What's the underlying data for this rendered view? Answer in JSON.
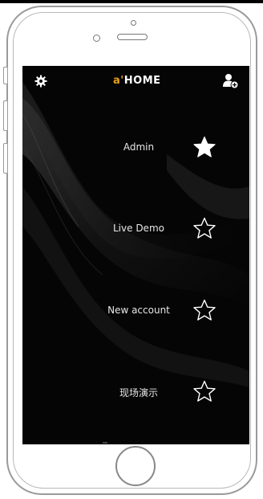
{
  "header": {
    "logo_accent": "a'",
    "logo_rest": "HOME",
    "settings_icon": "gear-icon",
    "add_user_icon": "add-user-icon"
  },
  "accounts": [
    {
      "label": "Admin",
      "favorite": true
    },
    {
      "label": "Live Demo",
      "favorite": false
    },
    {
      "label": "New account",
      "favorite": false
    },
    {
      "label": "现场演示",
      "favorite": false
    }
  ],
  "colors": {
    "screen_bg": "#050505",
    "logo_accent": "#e8a016",
    "text": "#e6e6e6"
  }
}
